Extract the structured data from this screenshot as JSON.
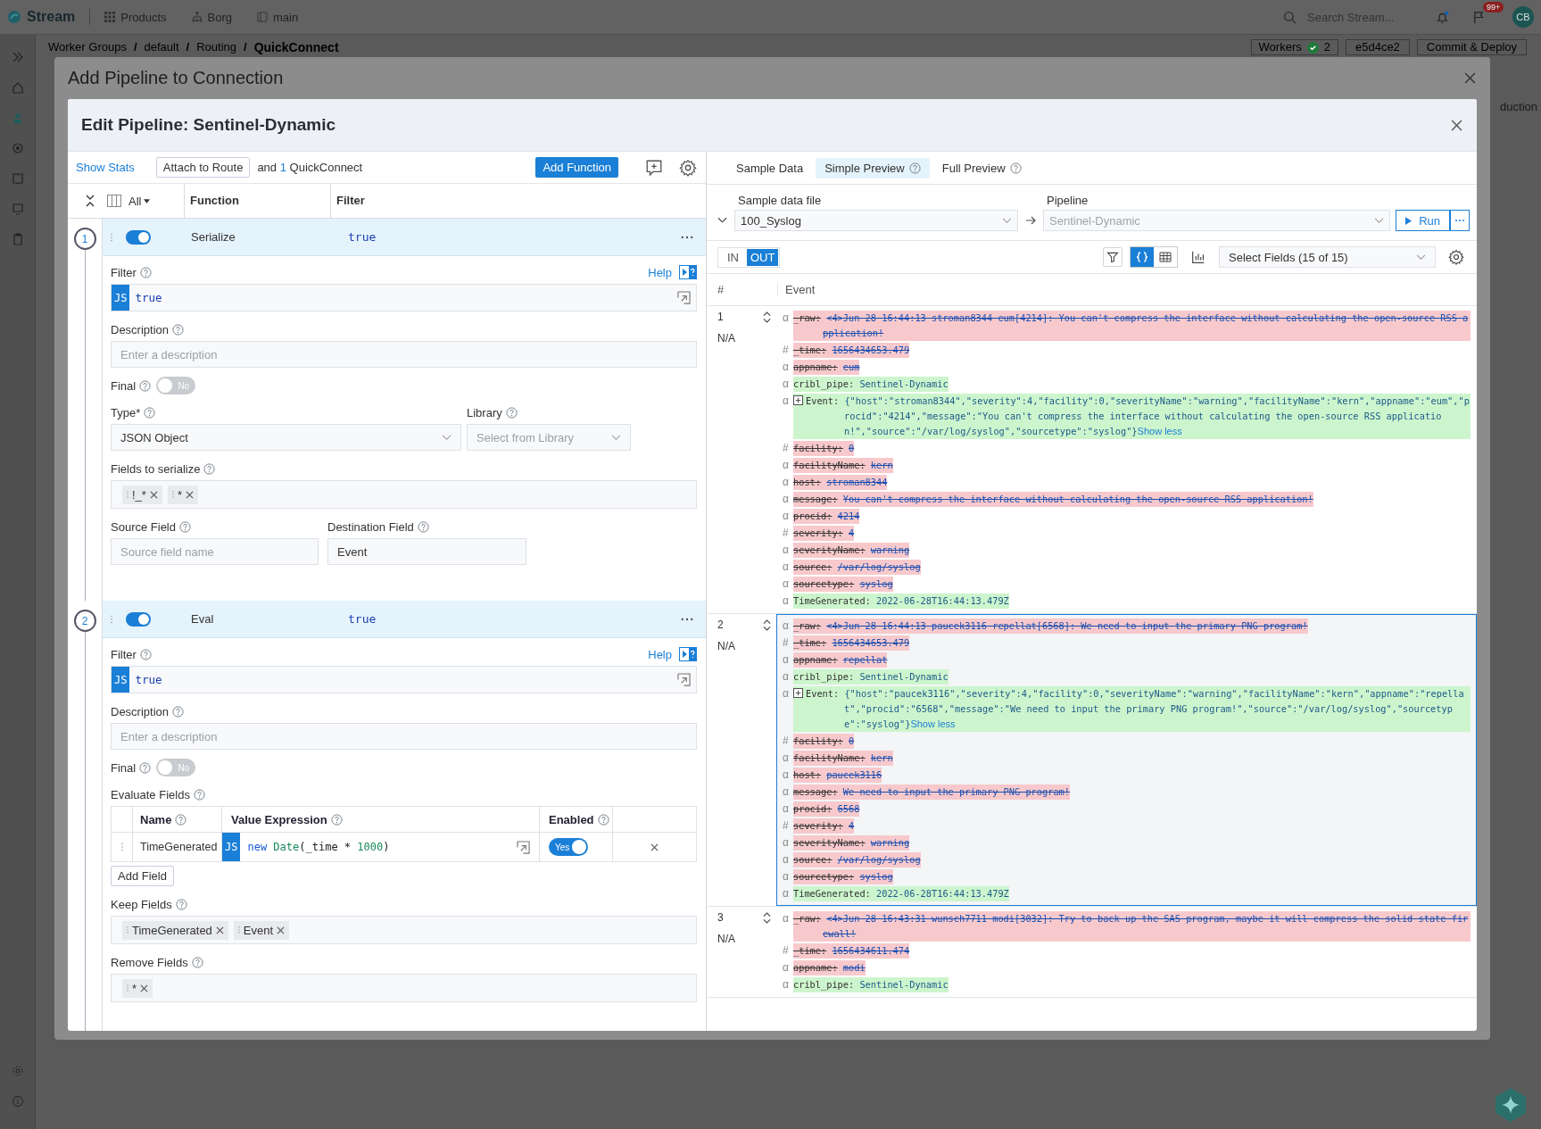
{
  "app": {
    "logo": "Stream",
    "nav": [
      {
        "label": "Products",
        "kind": "grid"
      },
      {
        "label": "Borg",
        "kind": "org"
      },
      {
        "label": "main",
        "kind": "branch"
      }
    ],
    "search": {
      "placeholder": "Search Stream..."
    },
    "notifications_badge": "99+",
    "avatar": "CB"
  },
  "breadcrumb": {
    "separator": "/",
    "items": [
      "Worker Groups",
      "default",
      "Routing",
      "QuickConnect"
    ]
  },
  "header_right": {
    "workers_label": "Workers",
    "workers_count": "2",
    "commit": "e5d4ce2",
    "deploy_button": "Commit & Deploy"
  },
  "background_text": "duction",
  "outer_modal": {
    "title": "Add Pipeline to Connection"
  },
  "editor": {
    "title": "Edit Pipeline: Sentinel-Dynamic",
    "toolbar": {
      "stats_link": "Show Stats",
      "attach_button": "Attach to Route",
      "attach_prefix": "and",
      "attach_count": "1",
      "attach_suffix": "QuickConnect",
      "add_button": "Add Function"
    },
    "columns": {
      "filter_all": "All",
      "function": "Function",
      "filter": "Filter"
    },
    "functions": [
      {
        "index": "1",
        "enabled": true,
        "name": "Serialize",
        "filter": "true",
        "body": [
          {
            "kind": "code",
            "label": "Filter",
            "help_link": "Help",
            "badge": "JS",
            "value": "true"
          },
          {
            "kind": "input",
            "label": "Description",
            "placeholder": "Enter a description"
          },
          {
            "kind": "toggle",
            "label": "Final",
            "on": false,
            "text": "No"
          },
          {
            "kind": "row",
            "items": [
              {
                "kind": "select",
                "label": "Type*",
                "value": "JSON Object"
              },
              {
                "kind": "select",
                "label": "Library",
                "placeholder": "Select from Library"
              }
            ]
          },
          {
            "kind": "tags",
            "label": "Fields to serialize",
            "tags": [
              "!_*",
              "*"
            ]
          },
          {
            "kind": "row",
            "items": [
              {
                "kind": "input",
                "label": "Source Field",
                "placeholder": "Source field name"
              },
              {
                "kind": "input",
                "label": "Destination Field",
                "value": "Event"
              }
            ]
          }
        ]
      },
      {
        "index": "2",
        "enabled": true,
        "name": "Eval",
        "filter": "true",
        "body": [
          {
            "kind": "code",
            "label": "Filter",
            "help_link": "Help",
            "badge": "JS",
            "value": "true"
          },
          {
            "kind": "input",
            "label": "Description",
            "placeholder": "Enter a description"
          },
          {
            "kind": "toggle",
            "label": "Final",
            "on": false,
            "text": "No"
          },
          {
            "kind": "table",
            "label": "Evaluate Fields",
            "columns": [
              "Name",
              "Value Expression",
              "Enabled"
            ],
            "rows": [
              {
                "name": "TimeGenerated",
                "badge": "JS",
                "tokens": [
                  {
                    "text": "new",
                    "kind": "keyword"
                  },
                  {
                    "text": "Date",
                    "kind": "builtin"
                  },
                  {
                    "text": "(_time * ",
                    "kind": "plain"
                  },
                  {
                    "text": "1000",
                    "kind": "number"
                  },
                  {
                    "text": ")",
                    "kind": "plain"
                  }
                ],
                "enabled": true,
                "enabled_text": "Yes"
              }
            ],
            "add_button": "Add Field"
          },
          {
            "kind": "tags",
            "label": "Keep Fields",
            "tags": [
              "TimeGenerated",
              "Event"
            ]
          },
          {
            "kind": "tags",
            "label": "Remove Fields",
            "tags": [
              "*"
            ]
          }
        ]
      }
    ]
  },
  "preview": {
    "tabs": [
      {
        "label": "Sample Data",
        "selected": false,
        "help": false
      },
      {
        "label": "Simple Preview",
        "selected": true,
        "help": true
      },
      {
        "label": "Full Preview",
        "selected": false,
        "help": true
      }
    ],
    "sample_file": {
      "label": "Sample data file",
      "value": "100_Syslog"
    },
    "pipeline": {
      "label": "Pipeline",
      "value": "Sentinel-Dynamic",
      "disabled": true
    },
    "run_button": "Run",
    "io_toggle": [
      {
        "label": "IN",
        "selected": false
      },
      {
        "label": "OUT",
        "selected": true
      }
    ],
    "view_modes": [
      {
        "kind": "json",
        "selected": true
      },
      {
        "kind": "table",
        "selected": false
      }
    ],
    "field_select": "Select Fields (15 of 15)",
    "columns": [
      "#",
      "Event"
    ],
    "events": [
      {
        "num": "1",
        "status": "N/A",
        "selected": false,
        "fields": [
          {
            "type": "α",
            "key": "_raw:",
            "value": "<4>Jun 28 16:44:13 stroman8344 eum[4214]: You can't compress the interface without calculating the open-source RSS application!",
            "kind": "removed"
          },
          {
            "type": "#",
            "key": "_time:",
            "value": "1656434653.479",
            "kind": "removed"
          },
          {
            "type": "α",
            "key": "appname:",
            "value": "eum",
            "kind": "removed"
          },
          {
            "type": "α",
            "key": "cribl_pipe:",
            "value": "Sentinel-Dynamic",
            "kind": "added"
          },
          {
            "type": "α",
            "key": "Event:",
            "value": "{\"host\":\"stroman8344\",\"severity\":4,\"facility\":0,\"severityName\":\"warning\",\"facilityName\":\"kern\",\"appname\":\"eum\",\"procid\":\"4214\",\"message\":\"You can't compress the interface without calculating the open-source RSS application!\",\"source\":\"/var/log/syslog\",\"sourcetype\":\"syslog\"}",
            "kind": "added",
            "expandable": true,
            "toggle_link": "Show less"
          },
          {
            "type": "#",
            "key": "facility:",
            "value": "0",
            "kind": "removed"
          },
          {
            "type": "α",
            "key": "facilityName:",
            "value": "kern",
            "kind": "removed"
          },
          {
            "type": "α",
            "key": "host:",
            "value": "stroman8344",
            "kind": "removed"
          },
          {
            "type": "α",
            "key": "message:",
            "value": "You can't compress the interface without calculating the open-source RSS application!",
            "kind": "removed"
          },
          {
            "type": "α",
            "key": "procid:",
            "value": "4214",
            "kind": "removed"
          },
          {
            "type": "#",
            "key": "severity:",
            "value": "4",
            "kind": "removed"
          },
          {
            "type": "α",
            "key": "severityName:",
            "value": "warning",
            "kind": "removed"
          },
          {
            "type": "α",
            "key": "source:",
            "value": "/var/log/syslog",
            "kind": "removed"
          },
          {
            "type": "α",
            "key": "sourcetype:",
            "value": "syslog",
            "kind": "removed"
          },
          {
            "type": "α",
            "key": "TimeGenerated:",
            "value": "2022-06-28T16:44:13.479Z",
            "kind": "added"
          }
        ]
      },
      {
        "num": "2",
        "status": "N/A",
        "selected": true,
        "fields": [
          {
            "type": "α",
            "key": "_raw:",
            "value": "<4>Jun 28 16:44:13 paucek3116 repellat[6568]: We need to input the primary PNG program!",
            "kind": "removed"
          },
          {
            "type": "#",
            "key": "_time:",
            "value": "1656434653.479",
            "kind": "removed"
          },
          {
            "type": "α",
            "key": "appname:",
            "value": "repellat",
            "kind": "removed"
          },
          {
            "type": "α",
            "key": "cribl_pipe:",
            "value": "Sentinel-Dynamic",
            "kind": "added"
          },
          {
            "type": "α",
            "key": "Event:",
            "value": "{\"host\":\"paucek3116\",\"severity\":4,\"facility\":0,\"severityName\":\"warning\",\"facilityName\":\"kern\",\"appname\":\"repellat\",\"procid\":\"6568\",\"message\":\"We need to input the primary PNG program!\",\"source\":\"/var/log/syslog\",\"sourcetype\":\"syslog\"}",
            "kind": "added",
            "expandable": true,
            "toggle_link": "Show less"
          },
          {
            "type": "#",
            "key": "facility:",
            "value": "0",
            "kind": "removed"
          },
          {
            "type": "α",
            "key": "facilityName:",
            "value": "kern",
            "kind": "removed"
          },
          {
            "type": "α",
            "key": "host:",
            "value": "paucek3116",
            "kind": "removed"
          },
          {
            "type": "α",
            "key": "message:",
            "value": "We need to input the primary PNG program!",
            "kind": "removed"
          },
          {
            "type": "α",
            "key": "procid:",
            "value": "6568",
            "kind": "removed"
          },
          {
            "type": "#",
            "key": "severity:",
            "value": "4",
            "kind": "removed"
          },
          {
            "type": "α",
            "key": "severityName:",
            "value": "warning",
            "kind": "removed"
          },
          {
            "type": "α",
            "key": "source:",
            "value": "/var/log/syslog",
            "kind": "removed"
          },
          {
            "type": "α",
            "key": "sourcetype:",
            "value": "syslog",
            "kind": "removed"
          },
          {
            "type": "α",
            "key": "TimeGenerated:",
            "value": "2022-06-28T16:44:13.479Z",
            "kind": "added"
          }
        ]
      },
      {
        "num": "3",
        "status": "N/A",
        "selected": false,
        "fields": [
          {
            "type": "α",
            "key": "_raw:",
            "value": "<4>Jun 28 16:43:31 wunsch7711 modi[3032]: Try to back up the SAS program, maybe it will compress the solid state firewall!",
            "kind": "removed"
          },
          {
            "type": "#",
            "key": "_time:",
            "value": "1656434611.474",
            "kind": "removed"
          },
          {
            "type": "α",
            "key": "appname:",
            "value": "modi",
            "kind": "removed"
          },
          {
            "type": "α",
            "key": "cribl_pipe:",
            "value": "Sentinel-Dynamic",
            "kind": "added"
          }
        ]
      }
    ]
  }
}
